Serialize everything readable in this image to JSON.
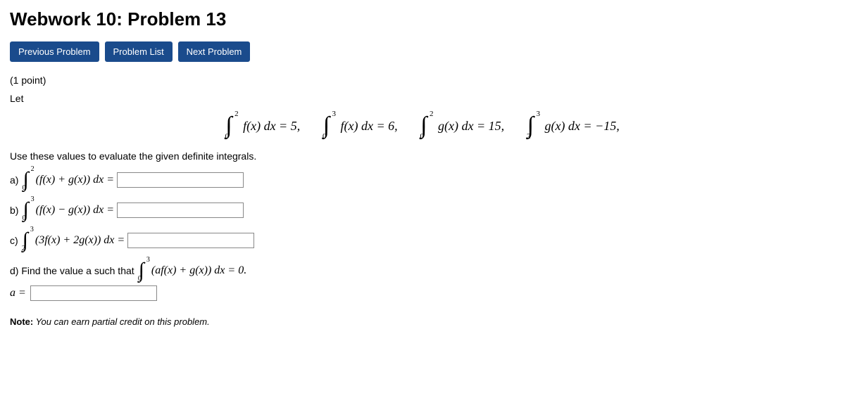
{
  "title": "Webwork 10: Problem 13",
  "buttons": {
    "prev": "Previous Problem",
    "list": "Problem List",
    "next": "Next Problem"
  },
  "points": "(1 point)",
  "let": "Let",
  "given": {
    "int1": {
      "lower": "0",
      "upper": "2",
      "body": "f(x) dx = 5,"
    },
    "int2": {
      "lower": "0",
      "upper": "3",
      "body": "f(x) dx = 6,"
    },
    "int3": {
      "lower": "0",
      "upper": "2",
      "body": "g(x) dx = 15,"
    },
    "int4": {
      "lower": "2",
      "upper": "3",
      "body": "g(x) dx = −15,"
    }
  },
  "instruction": "Use these values to evaluate the given definite integrals.",
  "parts": {
    "a": {
      "label": "a)",
      "lower": "0",
      "upper": "2",
      "body": "(f(x) + g(x)) dx ="
    },
    "b": {
      "label": "b)",
      "lower": "0",
      "upper": "3",
      "body": "(f(x) − g(x)) dx ="
    },
    "c": {
      "label": "c)",
      "lower": "2",
      "upper": "3",
      "body": "(3f(x) + 2g(x)) dx ="
    },
    "d": {
      "label": "d) Find the value a such that",
      "lower": "0",
      "upper": "3",
      "body": "(af(x) + g(x)) dx = 0."
    }
  },
  "a_equals": "a =",
  "note_bold": "Note:",
  "note_rest": " You can earn partial credit on this problem."
}
